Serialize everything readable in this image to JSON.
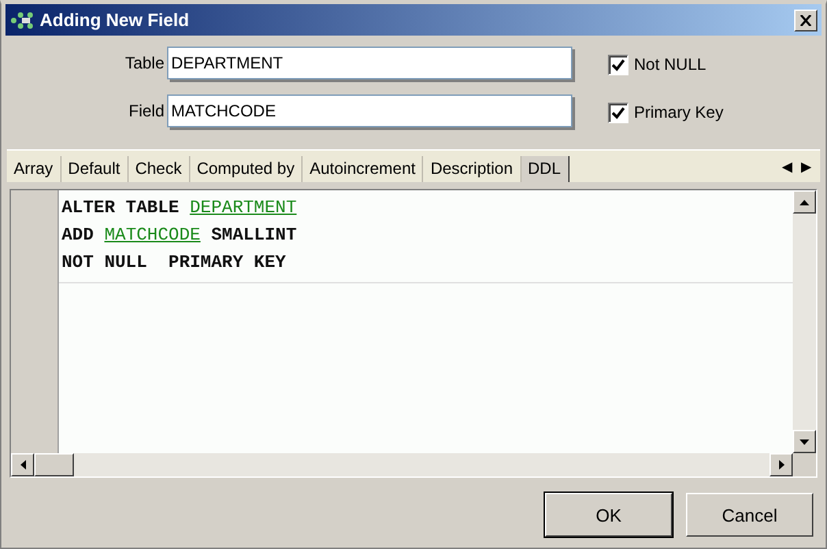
{
  "window": {
    "title": "Adding New Field"
  },
  "fields": [
    {
      "label": "Table",
      "value": "DEPARTMENT"
    },
    {
      "label": "Field",
      "value": "MATCHCODE"
    }
  ],
  "options": [
    {
      "label": "Not NULL",
      "checked": true
    },
    {
      "label": "Primary Key",
      "checked": true
    }
  ],
  "tabs": [
    {
      "label": "Array",
      "selected": false
    },
    {
      "label": "Default",
      "selected": false
    },
    {
      "label": "Check",
      "selected": false
    },
    {
      "label": "Computed by",
      "selected": false
    },
    {
      "label": "Autoincrement",
      "selected": false
    },
    {
      "label": "Description",
      "selected": false
    },
    {
      "label": "DDL",
      "selected": true
    }
  ],
  "tab_scroll": [
    "◀",
    "▶"
  ],
  "code": [
    [
      {
        "text": "ALTER TABLE ",
        "kind": "keyword"
      },
      {
        "text": "DEPARTMENT",
        "kind": "identifier"
      }
    ],
    [
      {
        "text": "ADD ",
        "kind": "keyword"
      },
      {
        "text": "MATCHCODE",
        "kind": "identifier"
      },
      {
        "text": " SMALLINT",
        "kind": "keyword"
      }
    ],
    [
      {
        "text": "NOT NULL  PRIMARY KEY",
        "kind": "keyword"
      }
    ]
  ],
  "buttons": [
    {
      "label": "OK",
      "default": true
    },
    {
      "label": "Cancel",
      "default": false
    }
  ]
}
